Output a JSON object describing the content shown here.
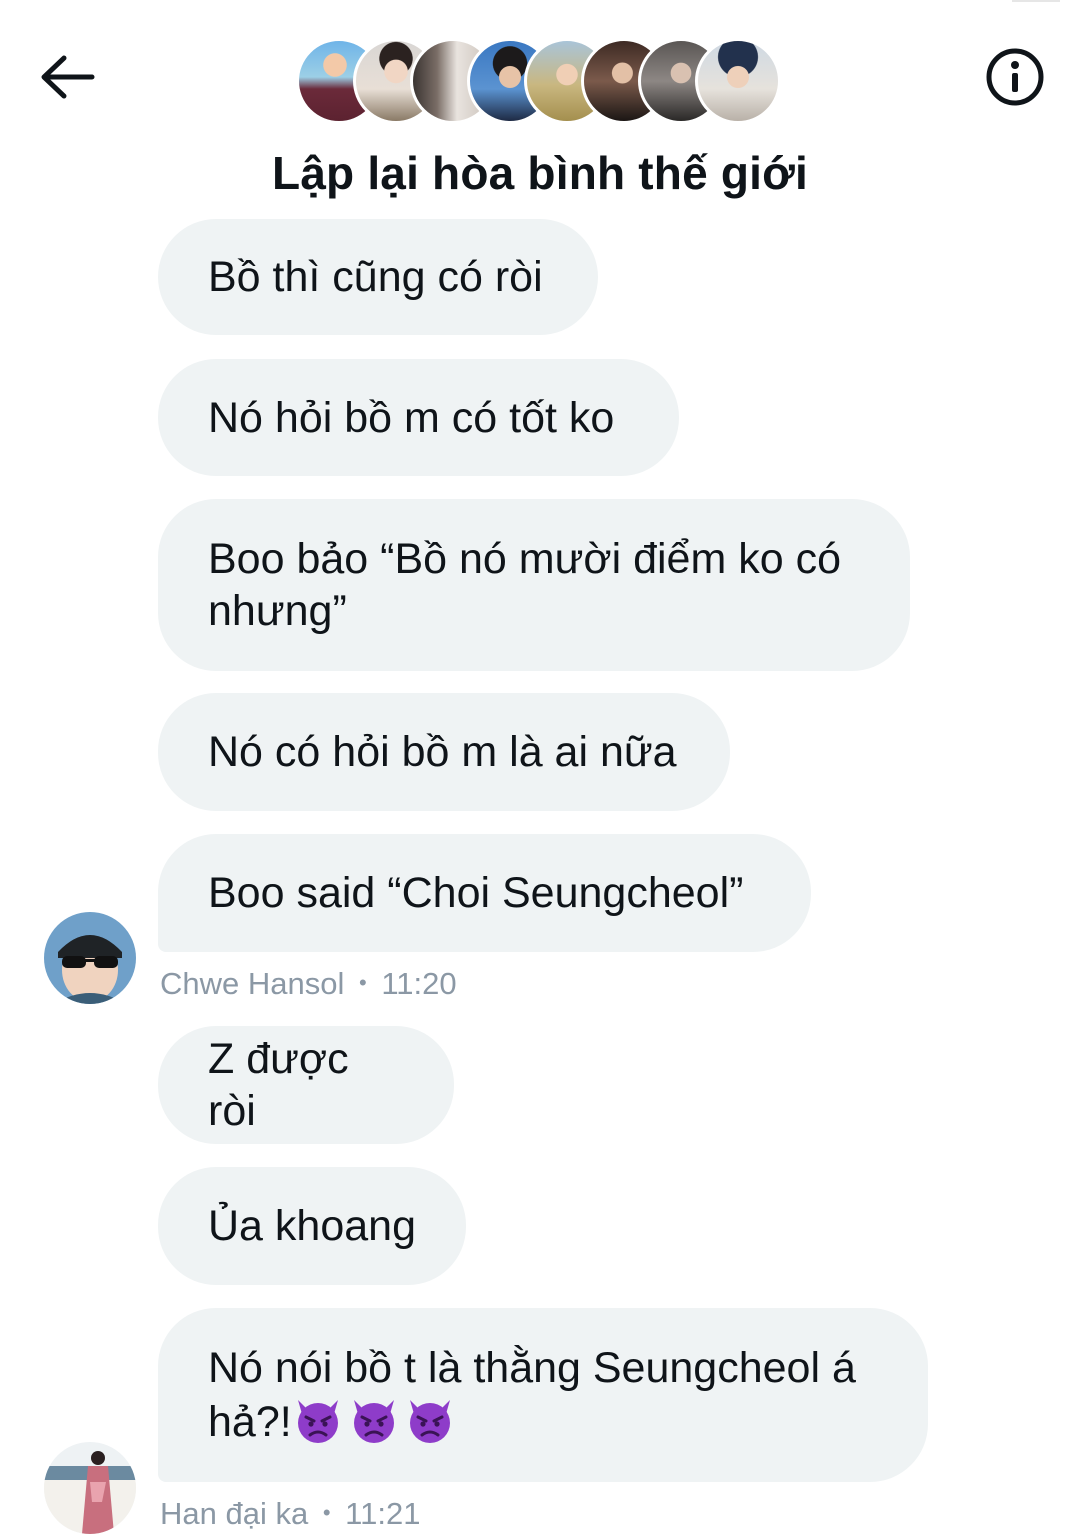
{
  "header": {
    "back_icon": "arrow-left-icon",
    "info_icon": "info-circle-icon",
    "title": "Lập lại hòa bình thế giới",
    "participant_count": 9
  },
  "messages": [
    {
      "text": "Bồ thì cũng có ròi"
    },
    {
      "text": "Nó hỏi bồ m có tốt ko"
    },
    {
      "text": "Boo bảo “Bồ nó mười điểm ko có nhưng”"
    },
    {
      "text": "Nó có hỏi bồ m là ai nữa"
    },
    {
      "text": "Boo said “Choi Seungcheol”"
    },
    {
      "text": "Z được ròi"
    },
    {
      "text": "Ủa khoang"
    },
    {
      "text": "Nó nói bồ t là thằng Seungcheol á hả?!",
      "emoji_icon": "angry-devil-emoji-icon",
      "emoji_count": 3
    }
  ],
  "groups": [
    {
      "sender": "Chwe Hansol",
      "time": "11:20",
      "separator": "•"
    },
    {
      "sender": "Han đại ka",
      "time": "11:21",
      "separator": "•"
    }
  ],
  "colors": {
    "bubble": "#eff3f4",
    "text": "#0f1419",
    "meta": "#8b98a5",
    "emoji": "#8e3cc9"
  }
}
